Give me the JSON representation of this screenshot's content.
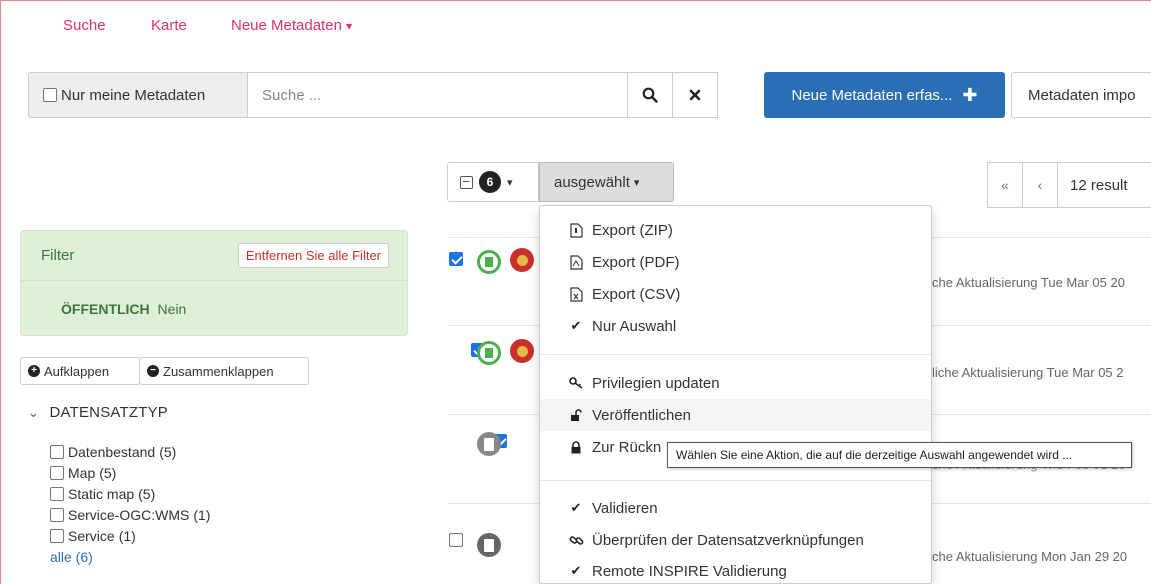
{
  "nav": {
    "search": "Suche",
    "map": "Karte",
    "new_metadata": "Neue Metadaten",
    "caret": "▾"
  },
  "searchbar": {
    "only_mine": "Nur meine Metadaten",
    "placeholder": "Suche ...",
    "search_icon": "search-icon",
    "clear_icon": "close-icon"
  },
  "actions": {
    "new_metadata_button": "Neue Metadaten erfas...",
    "plus": "✚",
    "import_button": "Metadaten impo"
  },
  "selection": {
    "count": "6",
    "dropdown_label": "ausgewählt",
    "caret": "▾"
  },
  "pager": {
    "first": "«",
    "prev": "‹",
    "results": "12 result"
  },
  "filter": {
    "title": "Filter",
    "remove_all": "Entfernen Sie alle Filter",
    "key": "ÖFFENTLICH",
    "value": "Nein"
  },
  "facets": {
    "expand": "Aufklappen",
    "collapse": "Zusammenklappen",
    "group_title": "DATENSATZTYP",
    "chevron": "⌄",
    "items": [
      {
        "label": "Datenbestand",
        "count": "(5)"
      },
      {
        "label": "Map",
        "count": "(5)"
      },
      {
        "label": "Static map",
        "count": "(5)"
      },
      {
        "label": "Service-OGC:WMS",
        "count": "(1)"
      },
      {
        "label": "Service",
        "count": "(1)"
      }
    ],
    "all": "alle (6)"
  },
  "results": [
    {
      "checked": true,
      "meta": "che Aktualisierung Tue Mar 05 20"
    },
    {
      "checked": true,
      "meta": "liche Aktualisierung Tue Mar 05 2"
    },
    {
      "checked": true,
      "meta": "che Aktualisierung Thu Feb 01 20"
    },
    {
      "checked": false,
      "meta": "che Aktualisierung Mon Jan 29 20"
    }
  ],
  "menu": {
    "export_zip": "Export (ZIP)",
    "export_pdf": "Export (PDF)",
    "export_csv": "Export (CSV)",
    "only_selection": "Nur Auswahl",
    "update_privileges": "Privilegien updaten",
    "publish": "Veröffentlichen",
    "unpublish": "Zur Rückn",
    "validate": "Validieren",
    "check_links": "Überprüfen der Datensatzverknüpfungen",
    "inspire_validation": "Remote INSPIRE Validierung"
  },
  "tooltip": "Wählen Sie eine Aktion, die auf die derzeitige Auswahl angewendet wird ...",
  "colors": {
    "nav_link": "#e0336b",
    "primary": "#2a6fb5",
    "filter_bg": "#dff0d8",
    "filter_text": "#3c763d",
    "danger": "#c9302c"
  }
}
